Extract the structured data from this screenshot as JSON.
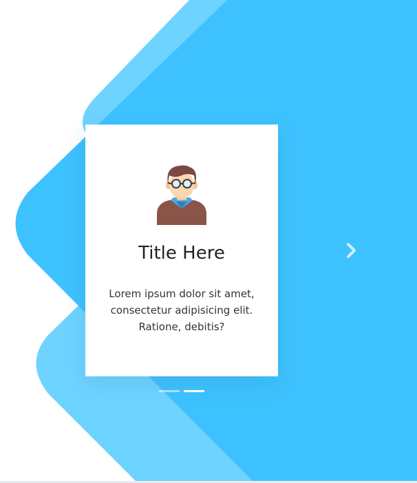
{
  "card": {
    "title": "Title Here",
    "text": "Lorem ipsum dolor sit amet, consectetur adipisicing elit. Ratione, debitis?",
    "avatar_icon": "person-with-glasses-icon"
  },
  "carousel": {
    "next_icon": "chevron-right-icon",
    "slide_count": 2,
    "active_slide": 2
  },
  "colors": {
    "primary_blue": "#3ec2ff",
    "light_blue": "#6fd3ff",
    "white": "#ffffff"
  }
}
